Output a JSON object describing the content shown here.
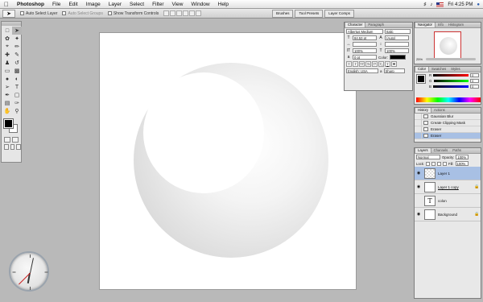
{
  "menubar": {
    "apple": "",
    "items": [
      "Photoshop",
      "File",
      "Edit",
      "Image",
      "Layer",
      "Select",
      "Filter",
      "View",
      "Window",
      "Help"
    ],
    "clock": "Fri 4:25 PM"
  },
  "options": {
    "auto_select_layer": "Auto Select Layer",
    "auto_select_groups": "Auto Select Groups",
    "show_transform": "Show Transform Controls",
    "well_tabs": [
      "Brushes",
      "Tool Presets",
      "Layer Comps"
    ]
  },
  "character": {
    "tab_character": "Character",
    "tab_paragraph": "Paragraph",
    "font_family": "Albertus Medium",
    "font_style": "Italic",
    "size": "84.53 pt",
    "leading": "(Auto)",
    "tracking": "",
    "kerning": "",
    "scale_v": "100%",
    "scale_h": "100%",
    "baseline": "0 pt",
    "color_label": "Color:",
    "language": "English: USA",
    "aa": "Sharp",
    "aa_prefix": "a"
  },
  "navigator": {
    "tab_navigator": "Navigator",
    "tab_info": "Info",
    "tab_histogram": "Histogram",
    "zoom": "25%"
  },
  "color": {
    "tab_color": "Color",
    "tab_swatches": "Swatches",
    "tab_styles": "Styles",
    "labels": [
      "R",
      "G",
      "B"
    ],
    "values": [
      "0",
      "0",
      "0"
    ]
  },
  "history": {
    "tab_history": "History",
    "tab_actions": "Actions",
    "items": [
      "Gaussian Blur",
      "Create Clipping Mask",
      "Eraser",
      "Eraser"
    ]
  },
  "layers": {
    "tab_layers": "Layers",
    "tab_channels": "Channels",
    "tab_paths": "Paths",
    "blend_mode": "Normal",
    "opacity_label": "Opacity:",
    "opacity": "100%",
    "lock_label": "Lock:",
    "fill_label": "Fill:",
    "fill": "100%",
    "items": [
      {
        "name": "Layer 1"
      },
      {
        "name": "Layer 1 copy"
      },
      {
        "name": "colon"
      },
      {
        "name": "Background"
      }
    ]
  }
}
